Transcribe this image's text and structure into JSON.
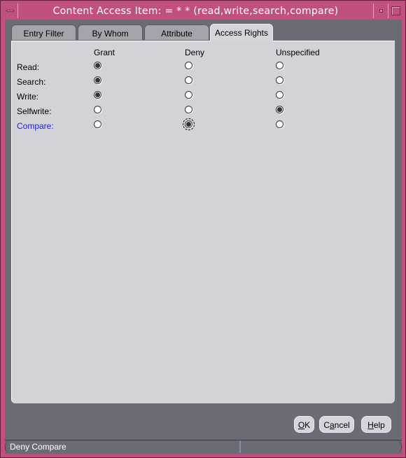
{
  "window": {
    "title": "Content Access Item:  = * * (read,write,search,compare)"
  },
  "tabs": [
    {
      "label": "Entry Filter",
      "active": false
    },
    {
      "label": "By Whom",
      "active": false
    },
    {
      "label": "Attribute",
      "active": false
    },
    {
      "label": "Access Rights",
      "active": true
    }
  ],
  "columns": [
    "Grant",
    "Deny",
    "Unspecified"
  ],
  "rows": [
    {
      "label": "Read:",
      "selected": "Grant"
    },
    {
      "label": "Search:",
      "selected": "Grant"
    },
    {
      "label": "Write:",
      "selected": "Grant"
    },
    {
      "label": "Selfwrite:",
      "selected": "Unspecified"
    },
    {
      "label": "Compare:",
      "selected": "Deny",
      "highlighted": true,
      "focused": true
    }
  ],
  "buttons": {
    "ok": {
      "mnemonic": "O",
      "rest": "K"
    },
    "cancel": {
      "pre": "C",
      "mnemonic": "a",
      "rest": "ncel"
    },
    "help": {
      "mnemonic": "H",
      "rest": "elp"
    }
  },
  "status": {
    "text": "Deny Compare"
  },
  "colors": {
    "frame": "#c0507f",
    "client": "#6b6b75",
    "panel": "#d2d2d9",
    "link": "#2020d0"
  }
}
